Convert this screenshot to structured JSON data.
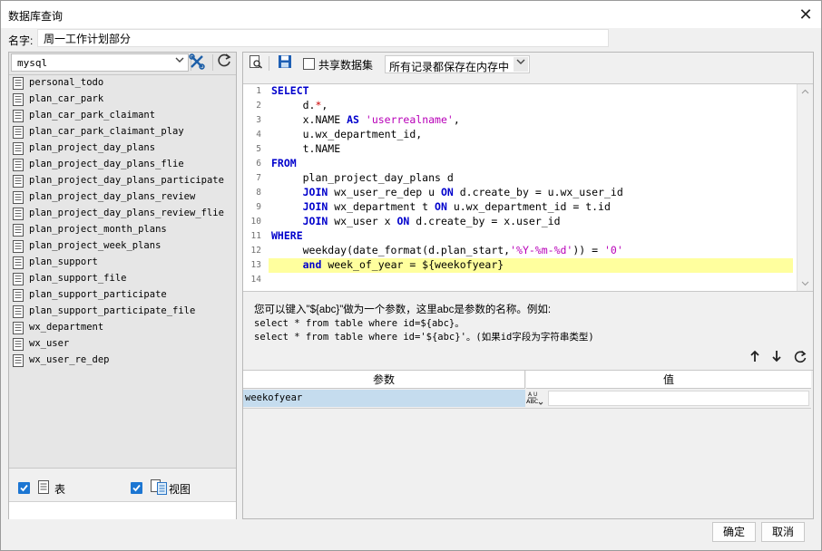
{
  "window": {
    "title": "数据库查询",
    "close_glyph": "✕"
  },
  "name_field": {
    "label": "名字:",
    "value": "周一工作计划部分"
  },
  "left": {
    "database": "mysql",
    "tables": [
      "personal_todo",
      "plan_car_park",
      "plan_car_park_claimant",
      "plan_car_park_claimant_play",
      "plan_project_day_plans",
      "plan_project_day_plans_flie",
      "plan_project_day_plans_participate",
      "plan_project_day_plans_review",
      "plan_project_day_plans_review_flie",
      "plan_project_month_plans",
      "plan_project_week_plans",
      "plan_support",
      "plan_support_file",
      "plan_support_participate",
      "plan_support_participate_file",
      "wx_department",
      "wx_user",
      "wx_user_re_dep"
    ],
    "show_tables_label": "表",
    "show_views_label": "视图"
  },
  "toolbar": {
    "share_dataset_label": "共享数据集",
    "storage_mode": "所有记录都保存在内存中"
  },
  "editor": {
    "line_numbers": [
      "1",
      "2",
      "3",
      "4",
      "5",
      "6",
      "7",
      "8",
      "9",
      "10",
      "11",
      "12",
      "13",
      "14"
    ]
  },
  "hint": {
    "line1": "您可以键入\"${abc}\"做为一个参数，这里abc是参数的名称。例如:",
    "line2": "select * from table where id=${abc}。",
    "line3": "select * from table where id='${abc}'。(如果id字段为字符串类型)"
  },
  "params": {
    "header_name": "参数",
    "header_value": "值",
    "rows": [
      {
        "name": "weekofyear",
        "type_icon": "ABC",
        "value": ""
      }
    ]
  },
  "footer": {
    "ok_label": "确定",
    "cancel_label": "取消"
  }
}
